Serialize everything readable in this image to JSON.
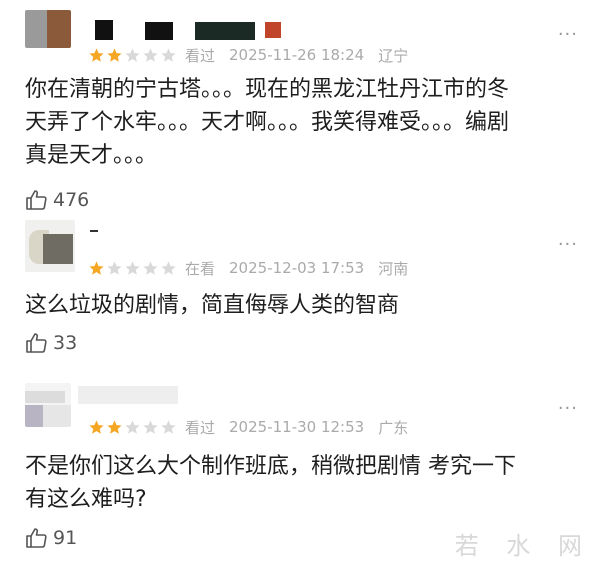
{
  "comments": [
    {
      "status": "看过",
      "date": "2025-11-26 18:24",
      "location": "辽宁",
      "rating": 2,
      "line1": "你在清朝的宁古塔。。。现在的黑龙江牡丹江市的冬",
      "line2": "天弄了个水牢。。。天才啊。。。我笑得难受。。。编剧",
      "line3": "真是天才。。。",
      "likes": "476"
    },
    {
      "status": "在看",
      "date": "2025-12-03 17:53",
      "location": "河南",
      "rating": 1,
      "line1": "这么垃圾的剧情，简直侮辱人类的智商",
      "likes": "33"
    },
    {
      "status": "看过",
      "date": "2025-11-30 12:53",
      "location": "广东",
      "rating": 2,
      "line1": "不是你们这么大个制作班底，稍微把剧情 考究一下",
      "line2": "有这么难吗?",
      "likes": "91"
    }
  ],
  "more_glyph": "···",
  "watermark": "若 水 网",
  "colors": {
    "star_on": "#f5a623",
    "star_off": "#d9d9d9",
    "meta": "#aaaaaa"
  }
}
